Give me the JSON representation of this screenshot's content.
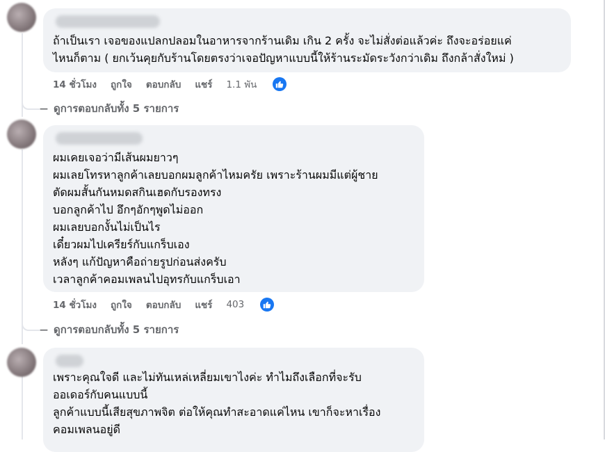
{
  "comments": [
    {
      "lines": [
        "ถ้าเป็นเรา เจอของแปลกปลอมในอาหารจากร้านเดิม เกิน 2 ครั้ง จะไม่สั่งต่อแล้วค่ะ ถึงจะอร่อยแค่",
        "ไหนก็ตาม ( ยกเว้นคุยกับร้านโดยตรงว่าเจอปัญหาแบบนี้ให้ร้านระมัดระวังกว่าเดิม ถึงกล้าสั่งใหม่ )"
      ],
      "time": "14 ชั่วโมง",
      "like_label": "ถูกใจ",
      "reply_label": "ตอบกลับ",
      "share_label": "แชร์",
      "reaction_count": "1.1 พัน",
      "view_replies": "ดูการตอบกลับทั้ง 5 รายการ"
    },
    {
      "lines": [
        "ผมเคยเจอว่ามีเส้นผมยาวๆ",
        "ผมเลยโทรหาลูกค้าเลยบอกผมลูกค้าไหมครัย เพราะร้านผมมีแต่ผู้ชาย",
        "ตัดผมสั้นกันหมดสกินเฮดกับรองทรง",
        "บอกลูกค้าไป อึกๆอักๆพูดไม่ออก",
        "ผมเลยบอกงั้นไม่เป็นไร",
        "เดี๋ยวผมไปเครียร์กับแกร็บเอง",
        "หลังๆ แก้ปัญหาคือถ่ายรูปก่อนส่งครับ",
        "เวลาลูกค้าคอมเพลนไปอุทรกับแกร็บเอา"
      ],
      "time": "14 ชั่วโมง",
      "like_label": "ถูกใจ",
      "reply_label": "ตอบกลับ",
      "share_label": "แชร์",
      "reaction_count": "403",
      "view_replies": "ดูการตอบกลับทั้ง 5 รายการ"
    },
    {
      "lines": [
        "เพราะคุณใจดี และไม่ทันเหล่เหลี่ยมเขาไงค่ะ ทำไมถึงเลือกที่จะรับ",
        "ออเดอร์กับคนแบบนี้",
        "ลูกค้าแบบนี้เสียสุขภาพจิต ต่อให้คุณทำสะอาดแค่ไหน เขาก็จะหาเรื่อง",
        "คอมเพลนอยู่ดี"
      ]
    }
  ],
  "colors": {
    "bubble": "#f0f2f5",
    "meta": "#65676b",
    "like_blue": "#1877f2"
  },
  "icons": {
    "like": "thumbs-up-icon",
    "replies_arrow": "reply-arrow-icon"
  }
}
